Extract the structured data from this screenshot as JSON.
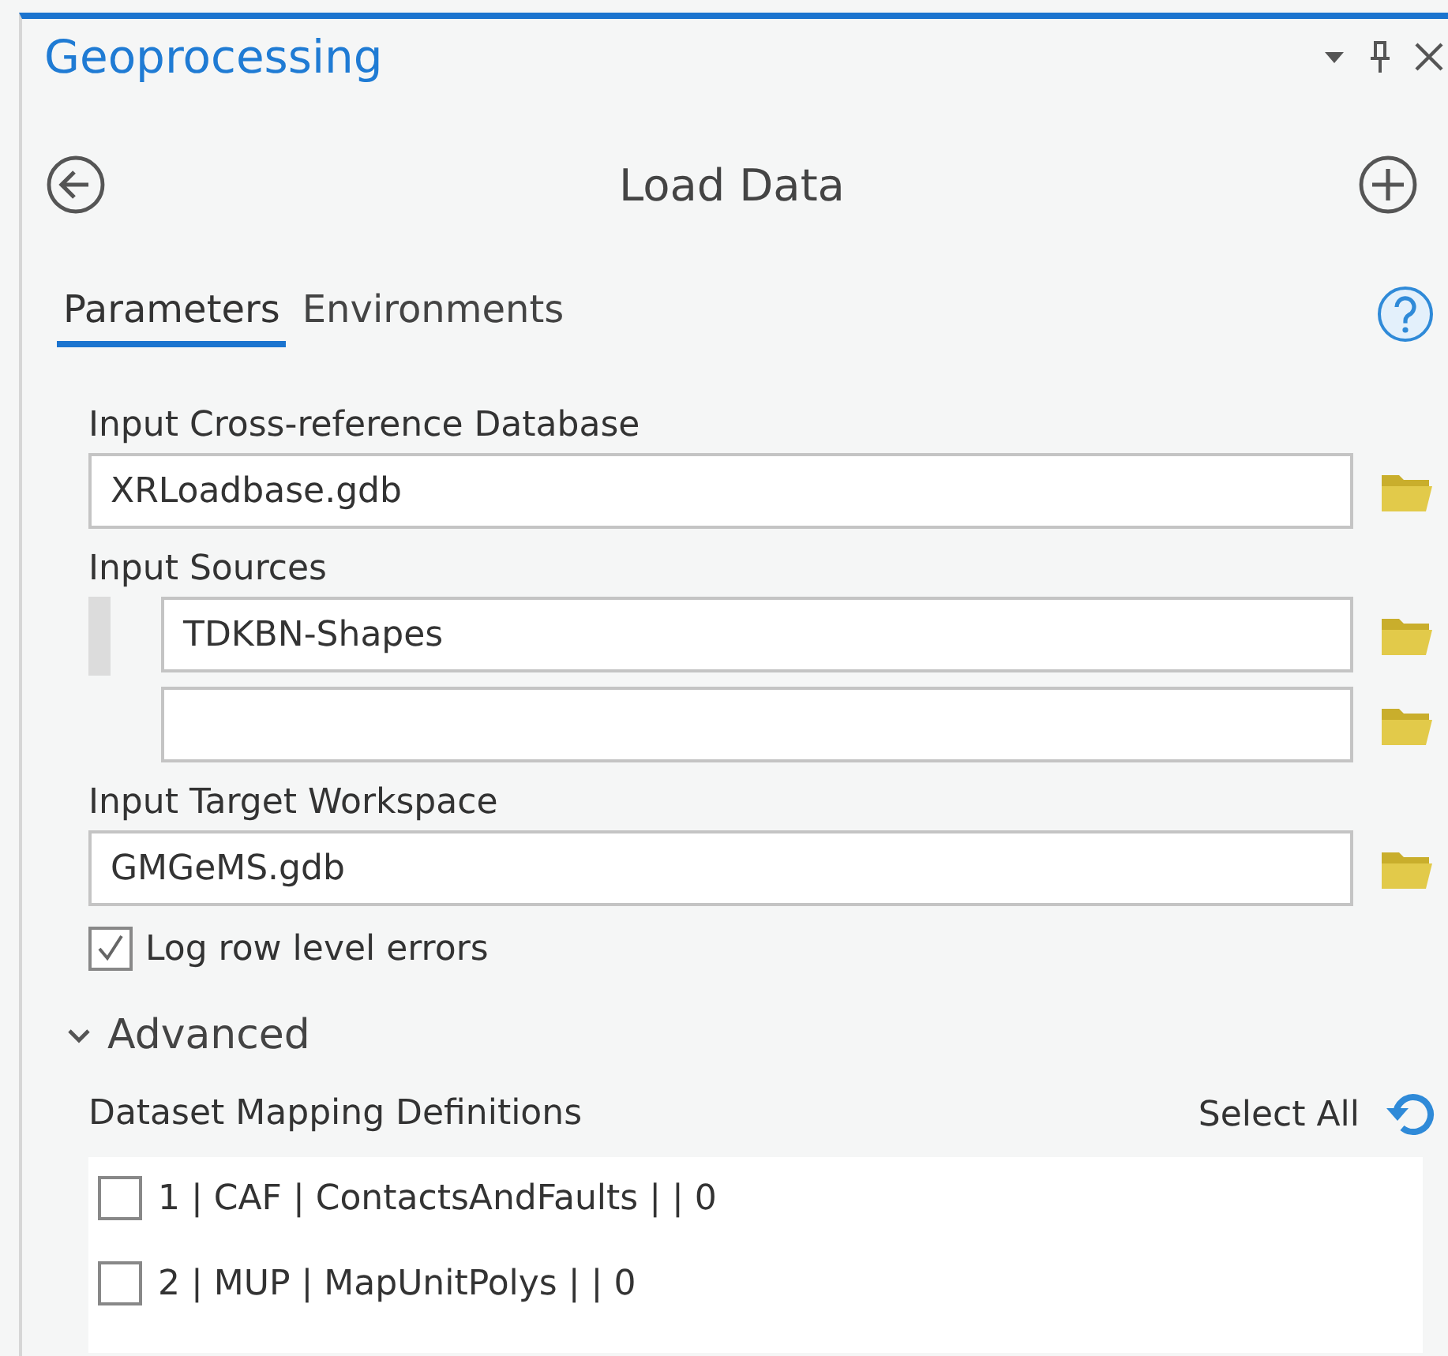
{
  "panel": {
    "title": "Geoprocessing"
  },
  "tool": {
    "title": "Load Data"
  },
  "tabs": [
    {
      "label": "Parameters",
      "selected": true
    },
    {
      "label": "Environments",
      "selected": false
    }
  ],
  "parameters": [
    {
      "kind": "field",
      "label": "Input Cross-reference Database",
      "value": "XRLoadbase.gdb"
    },
    {
      "kind": "multi",
      "label": "Input Sources",
      "values": [
        "TDKBN-Shapes"
      ]
    },
    {
      "kind": "field",
      "label": "Input Target Workspace",
      "value": "GMGeMS.gdb"
    },
    {
      "kind": "checkbox",
      "label": "Log row level errors",
      "checked": true
    }
  ],
  "advanced": {
    "label": "Advanced",
    "expanded": true,
    "list_label": "Dataset Mapping Definitions",
    "select_all": "Select All",
    "items": [
      {
        "label": "1 | CAF | ContactsAndFaults | | 0",
        "checked": false
      },
      {
        "label": "2 | MUP | MapUnitPolys | | 0",
        "checked": false
      }
    ]
  }
}
